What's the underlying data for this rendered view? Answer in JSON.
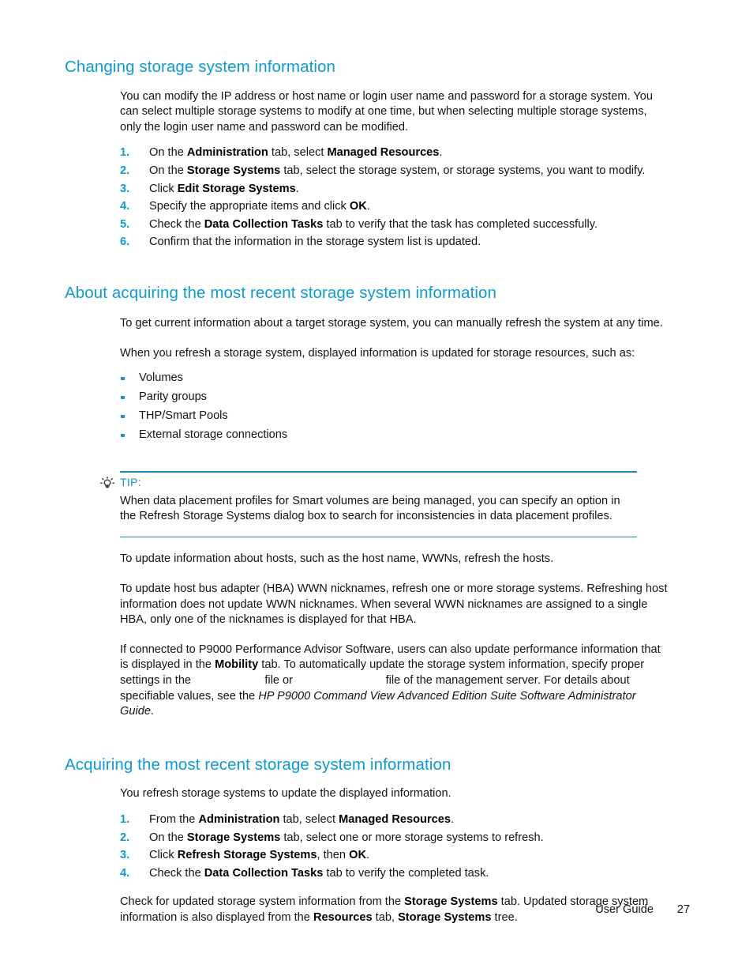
{
  "page": {
    "heading_color": "#0b9bd7",
    "accent_color": "#1592d3",
    "rule_color": "#1b87b9",
    "text_color": "#131313"
  },
  "sections": {
    "changing": {
      "heading": "Changing storage system information",
      "intro": "You can modify the IP address or host name or login user name and password for a storage system. You can select multiple storage systems to modify at one time, but when selecting multiple storage systems, only the login user name and password can be modified.",
      "steps": [
        {
          "pre": "On the ",
          "b1": "Administration",
          "mid": " tab, select ",
          "b2": "Managed Resources",
          "post": "."
        },
        {
          "pre": "On the ",
          "b1": "Storage Systems",
          "mid": " tab, select the storage system, or storage systems, you want to modify.",
          "b2": "",
          "post": ""
        },
        {
          "pre": "Click ",
          "b1": "Edit Storage Systems",
          "mid": "",
          "b2": "",
          "post": "."
        },
        {
          "pre": "Specify the appropriate items and click ",
          "b1": "OK",
          "mid": "",
          "b2": "",
          "post": "."
        },
        {
          "pre": "Check the ",
          "b1": "Data Collection Tasks",
          "mid": " tab to verify that the task has completed successfully.",
          "b2": "",
          "post": ""
        },
        {
          "pre": "Confirm that the information in the storage system list is updated.",
          "b1": "",
          "mid": "",
          "b2": "",
          "post": ""
        }
      ]
    },
    "about_acquiring": {
      "heading": "About acquiring the most recent storage system information",
      "para1": "To get current information about a target storage system, you can manually refresh the system at any time.",
      "para2": "When you refresh a storage system, displayed information is updated for storage resources, such as:",
      "bullets": [
        "Volumes",
        "Parity groups",
        "THP/Smart Pools",
        "External storage connections"
      ],
      "tip": {
        "icon": "lightbulb-icon",
        "label": "TIP:",
        "body": "When data placement profiles for Smart volumes are being managed, you can specify an option in the Refresh Storage Systems dialog box to search for inconsistencies in data placement profiles."
      },
      "para3": "To update information about hosts, such as the host name, WWNs, refresh the hosts.",
      "para4": "To update host bus adapter (HBA) WWN nicknames, refresh one or more storage systems. Refreshing host information does not update WWN nicknames. When several WWN nicknames are assigned to a single HBA, only one of the nicknames is displayed for that HBA.",
      "para5": {
        "t1": "If connected to P9000 Performance Advisor Software, users can also update performance information that is displayed in the ",
        "b1": "Mobility",
        "t2": " tab. To automatically update the storage system information, specify proper settings in the ",
        "blank1": "                     ",
        "t3": " file or ",
        "blank2": "                           ",
        "t4": " file of the management server. For details about specifiable values, see the ",
        "i1": "HP P9000 Command View Advanced Edition Suite Software Administrator Guide",
        "t5": "."
      }
    },
    "acquiring": {
      "heading": "Acquiring the most recent storage system information",
      "intro": "You refresh storage systems to update the displayed information.",
      "steps": [
        {
          "pre": "From the ",
          "b1": "Administration",
          "mid": " tab, select ",
          "b2": "Managed Resources",
          "post": "."
        },
        {
          "pre": "On the ",
          "b1": "Storage Systems",
          "mid": " tab, select one or more storage systems to refresh.",
          "b2": "",
          "post": ""
        },
        {
          "pre": "Click ",
          "b1": "Refresh Storage Systems",
          "mid": ", then ",
          "b2": "OK",
          "post": "."
        },
        {
          "pre": "Check the ",
          "b1": "Data Collection Tasks",
          "mid": " tab to verify the completed task.",
          "b2": "",
          "post": ""
        }
      ],
      "closing": {
        "t1": "Check for updated storage system information from the ",
        "b1": "Storage Systems",
        "t2": " tab. Updated storage system information is also displayed from the ",
        "b2": "Resources",
        "t3": " tab, ",
        "b3": "Storage Systems",
        "t4": " tree."
      }
    }
  },
  "footer": {
    "label": "User Guide",
    "page_number": "27"
  }
}
